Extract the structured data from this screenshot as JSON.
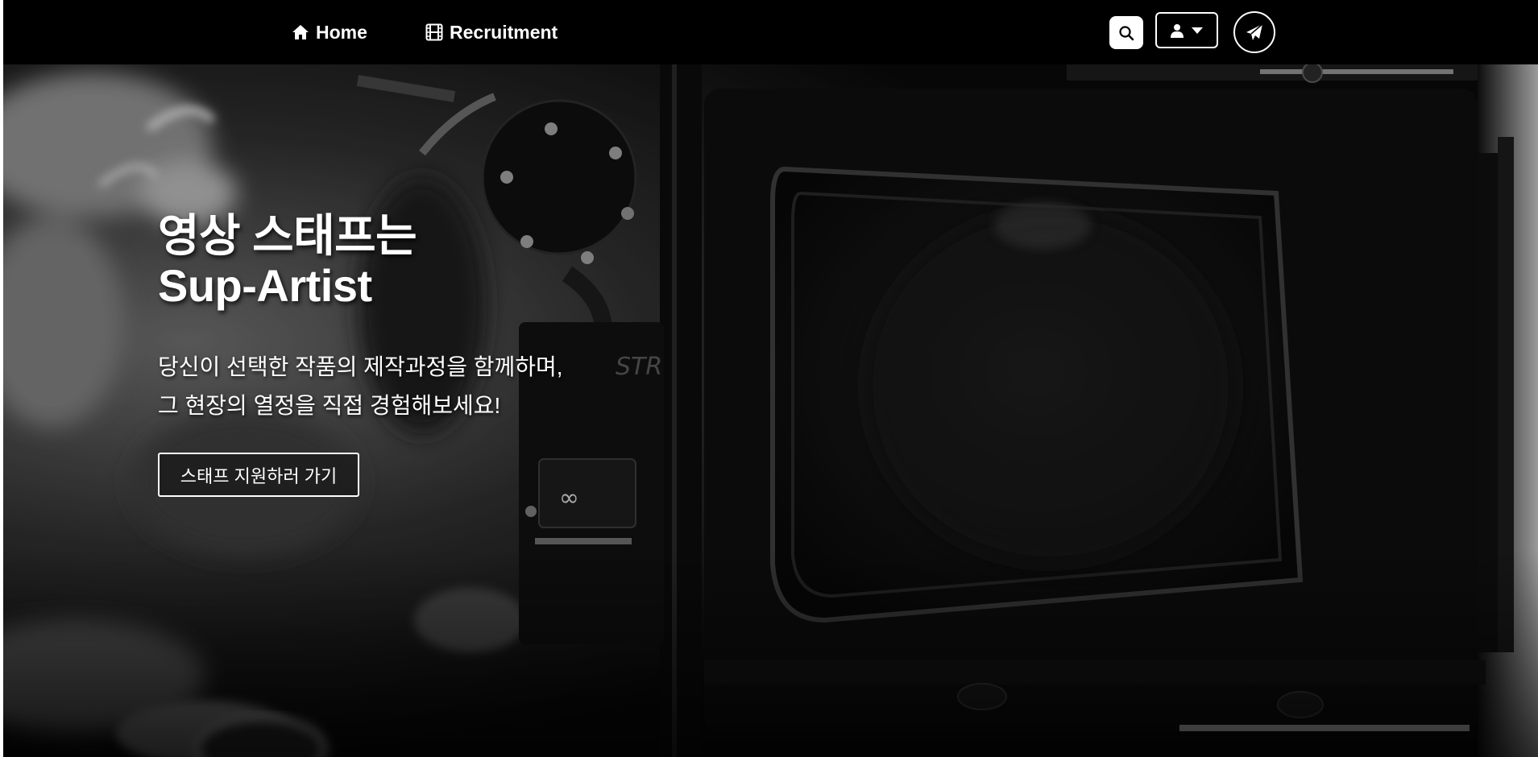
{
  "nav": {
    "home_label": "Home",
    "recruitment_label": "Recruitment",
    "icons": {
      "home": "home-icon",
      "recruitment": "film-icon",
      "search": "search-icon",
      "user": "user-icon",
      "dropdown": "caret-down-icon",
      "send": "paper-plane-icon"
    }
  },
  "hero": {
    "title_line1": "영상 스태프는",
    "title_line2": "Sup-Artist",
    "desc_line1": "당신이 선택한 작품의 제작과정을 함께하며,",
    "desc_line2": "그 현장의 열정을 직접 경험해보세요!",
    "cta_label": "스태프 지원하러 가기"
  },
  "colors": {
    "navbar_bg": "#000000",
    "text": "#ffffff",
    "hero_bg": "#0b0b0b"
  }
}
